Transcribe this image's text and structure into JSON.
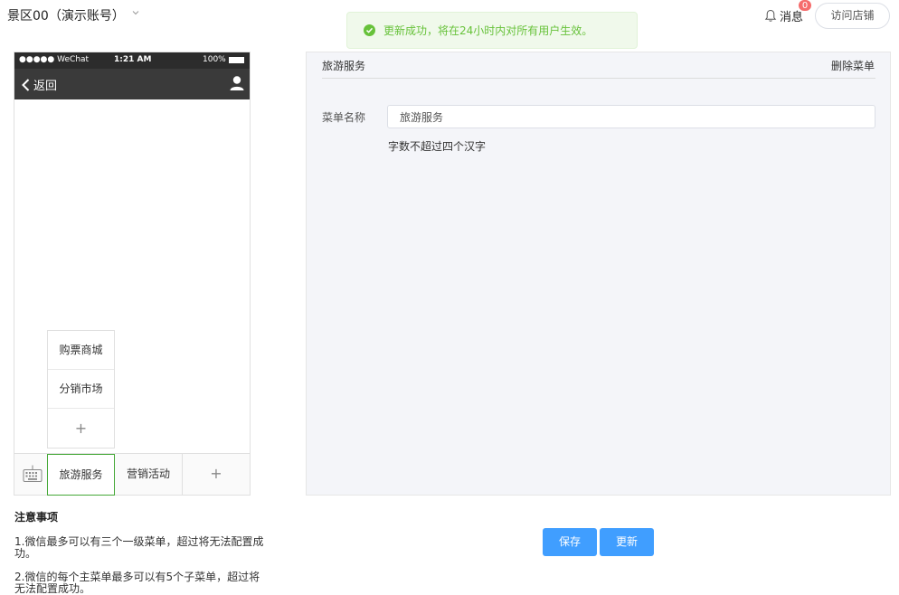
{
  "header": {
    "shop_name": "景区00（演示账号）",
    "toast": "更新成功，将在24小时内对所有用户生效。",
    "messages_label": "消息",
    "messages_badge": "0",
    "visit_store": "访问店铺"
  },
  "phone": {
    "carrier": "●●●●● WeChat",
    "time": "1:21 AM",
    "battery": "100%",
    "back_label": "返回"
  },
  "sub_menu": [
    "购票商城",
    "分销市场",
    "+"
  ],
  "menu_bar": [
    "旅游服务",
    "营销活动",
    "+"
  ],
  "editor": {
    "title": "旅游服务",
    "delete_label": "删除菜单",
    "name_label": "菜单名称",
    "name_value": "旅游服务",
    "hint": "字数不超过四个汉字"
  },
  "notes": {
    "title": "注意事项",
    "item1": "1.微信最多可以有三个一级菜单，超过将无法配置成功。",
    "item2": "2.微信的每个主菜单最多可以有5个子菜单，超过将无法配置成功。"
  },
  "actions": {
    "save": "保存",
    "update": "更新"
  },
  "colors": {
    "accent": "#409eff",
    "success": "#67c23a",
    "active_menu_border": "#45a837"
  }
}
